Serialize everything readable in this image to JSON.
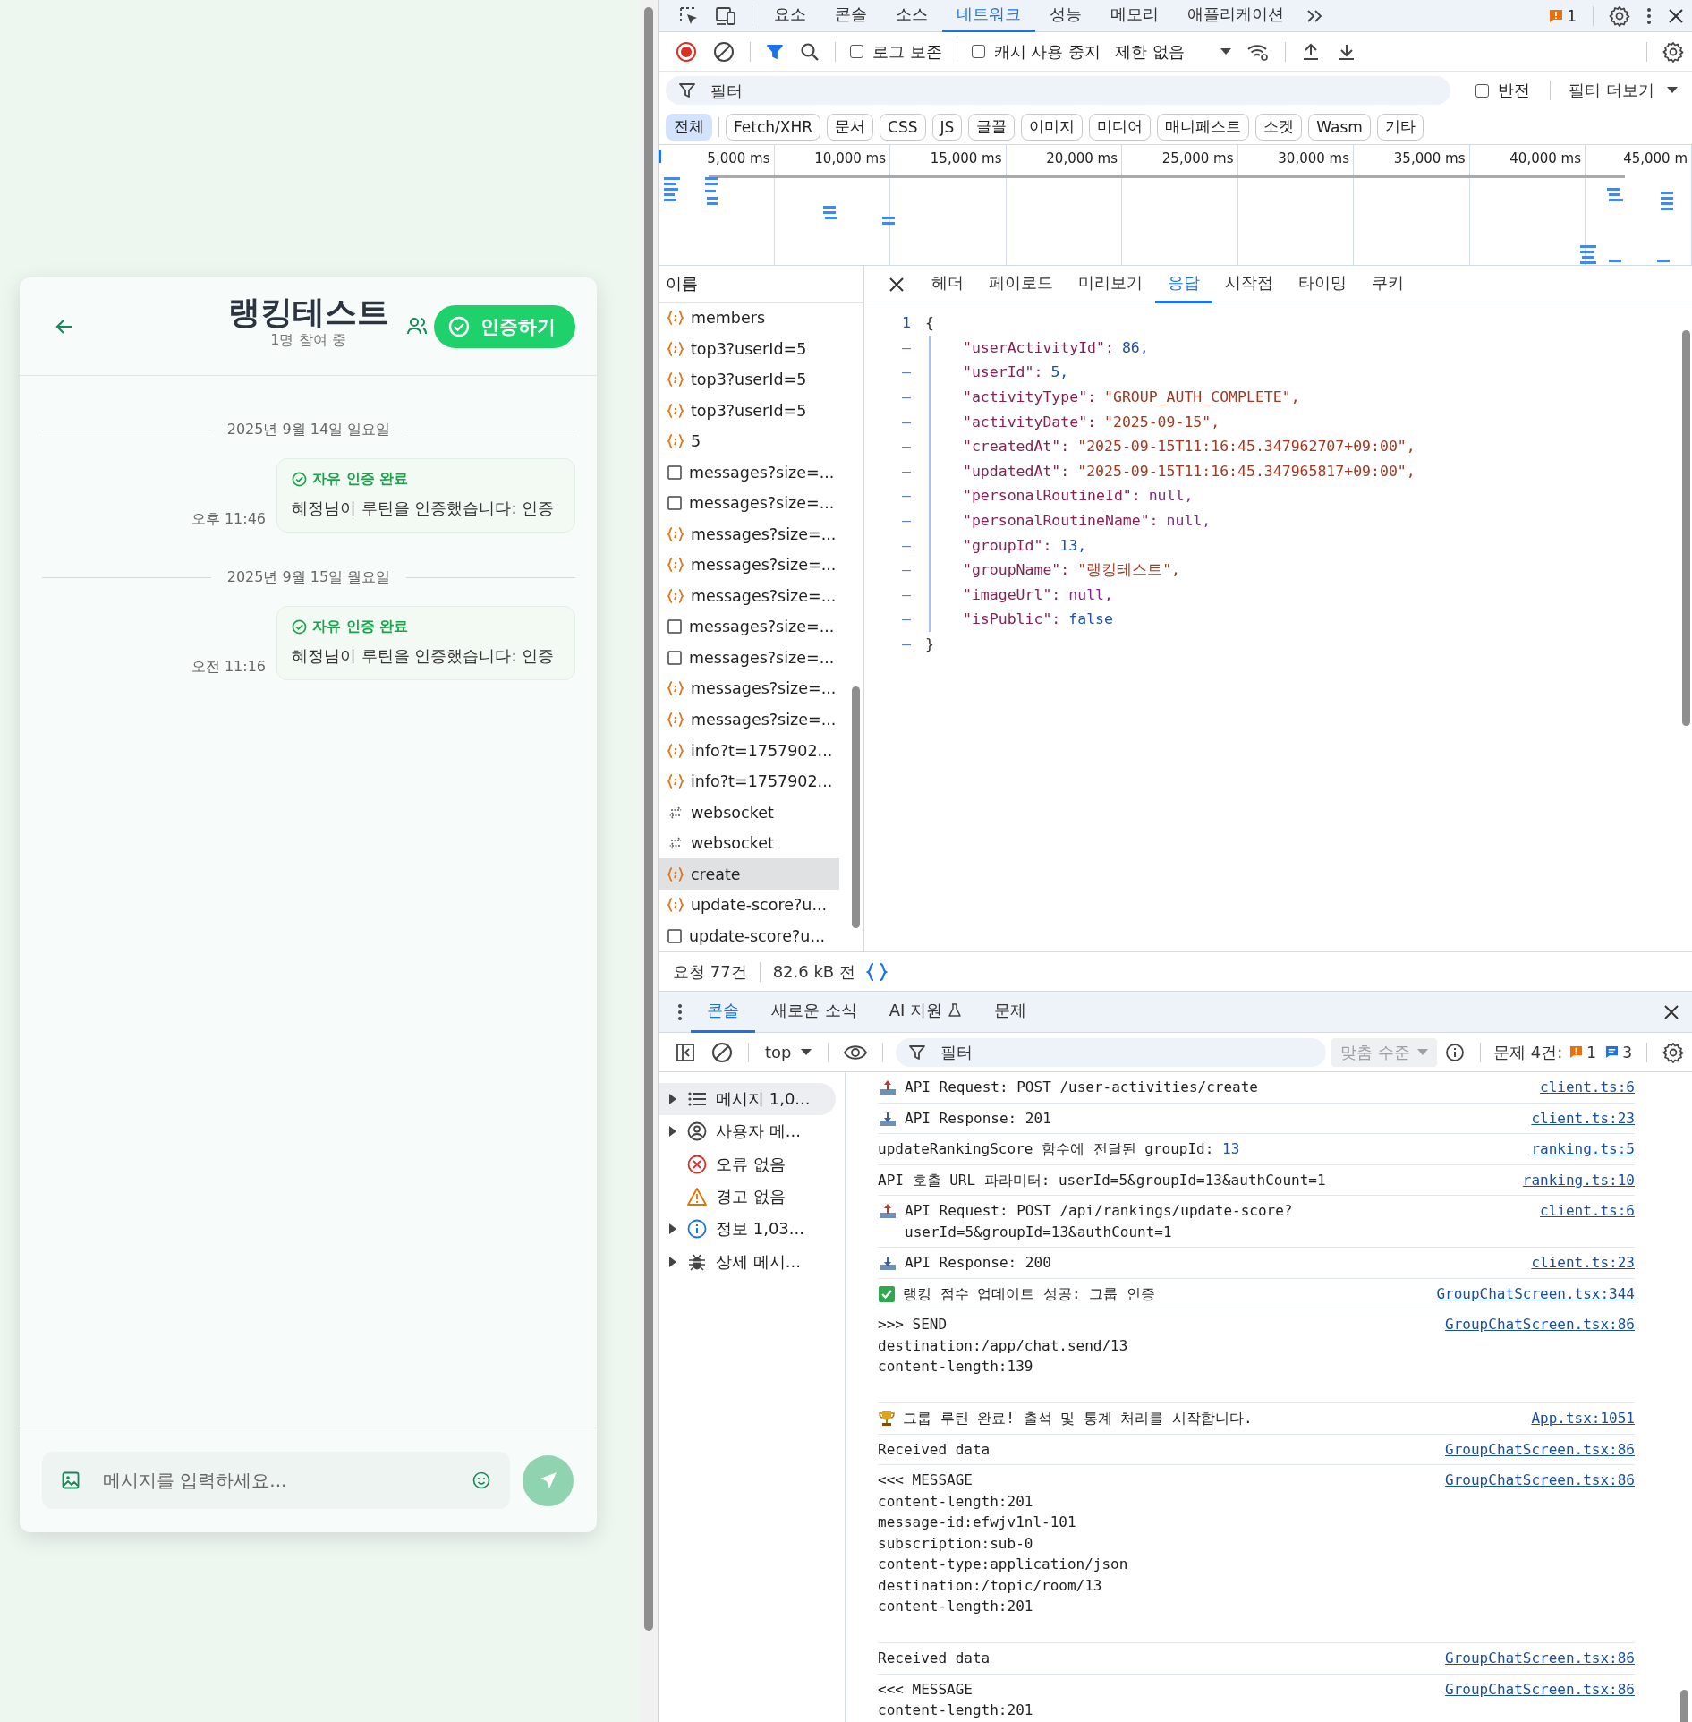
{
  "chat": {
    "title": "랭킹테스트",
    "subtitle": "1명 참여 중",
    "action_button": "인증하기",
    "timeline": [
      {
        "kind": "date",
        "text": "2025년 9월 14일 일요일"
      },
      {
        "kind": "message",
        "label": "자유 인증 완료",
        "text": "혜정님이 루틴을 인증했습니다: 인증",
        "time": "오후 11:46"
      },
      {
        "kind": "date",
        "text": "2025년 9월 15일 월요일"
      },
      {
        "kind": "message",
        "label": "자유 인증 완료",
        "text": "혜정님이 루틴을 인증했습니다: 인증",
        "time": "오전 11:16"
      }
    ],
    "input": {
      "placeholder": "메시지를 입력하세요..."
    }
  },
  "devtools": {
    "main_tabs": [
      {
        "label": "요소",
        "selected": false
      },
      {
        "label": "콘솔",
        "selected": false
      },
      {
        "label": "소스",
        "selected": false
      },
      {
        "label": "네트워크",
        "selected": true
      },
      {
        "label": "성능",
        "selected": false
      },
      {
        "label": "메모리",
        "selected": false
      },
      {
        "label": "애플리케이션",
        "selected": false
      }
    ],
    "issues_badge": "1",
    "network_toolbar": {
      "preserve_log": {
        "label": "로그 보존",
        "checked": false
      },
      "disable_cache": {
        "label": "캐시 사용 중지",
        "checked": false
      },
      "throttling": "제한 없음"
    },
    "filter": {
      "placeholder": "필터",
      "invert": {
        "label": "반전",
        "checked": false
      },
      "more_filters": "필터 더보기"
    },
    "type_filters": [
      {
        "label": "전체",
        "selected": true
      },
      {
        "label": "Fetch/XHR",
        "selected": false
      },
      {
        "label": "문서",
        "selected": false
      },
      {
        "label": "CSS",
        "selected": false
      },
      {
        "label": "JS",
        "selected": false
      },
      {
        "label": "글꼴",
        "selected": false
      },
      {
        "label": "이미지",
        "selected": false
      },
      {
        "label": "미디어",
        "selected": false
      },
      {
        "label": "매니페스트",
        "selected": false
      },
      {
        "label": "소켓",
        "selected": false
      },
      {
        "label": "Wasm",
        "selected": false
      },
      {
        "label": "기타",
        "selected": false
      }
    ],
    "timeline": {
      "ticks": [
        "5,000 ms",
        "10,000 ms",
        "15,000 ms",
        "20,000 ms",
        "25,000 ms",
        "30,000 ms",
        "35,000 ms",
        "40,000 ms",
        "45,000 m"
      ]
    },
    "requests": {
      "header": "이름",
      "items": [
        {
          "name": "members",
          "kind": "fetch",
          "selected": false
        },
        {
          "name": "top3?userId=5",
          "kind": "fetch",
          "selected": false
        },
        {
          "name": "top3?userId=5",
          "kind": "fetch",
          "selected": false
        },
        {
          "name": "top3?userId=5",
          "kind": "fetch",
          "selected": false
        },
        {
          "name": "5",
          "kind": "fetch",
          "selected": false
        },
        {
          "name": "messages?size=...",
          "kind": "document",
          "selected": false
        },
        {
          "name": "messages?size=...",
          "kind": "document",
          "selected": false
        },
        {
          "name": "messages?size=...",
          "kind": "fetch",
          "selected": false
        },
        {
          "name": "messages?size=...",
          "kind": "fetch",
          "selected": false
        },
        {
          "name": "messages?size=...",
          "kind": "fetch",
          "selected": false
        },
        {
          "name": "messages?size=...",
          "kind": "document",
          "selected": false
        },
        {
          "name": "messages?size=...",
          "kind": "document",
          "selected": false
        },
        {
          "name": "messages?size=...",
          "kind": "fetch",
          "selected": false
        },
        {
          "name": "messages?size=...",
          "kind": "fetch",
          "selected": false
        },
        {
          "name": "info?t=1757902...",
          "kind": "fetch",
          "selected": false
        },
        {
          "name": "info?t=1757902...",
          "kind": "fetch",
          "selected": false
        },
        {
          "name": "websocket",
          "kind": "websocket",
          "selected": false
        },
        {
          "name": "websocket",
          "kind": "websocket",
          "selected": false
        },
        {
          "name": "create",
          "kind": "fetch",
          "selected": true
        },
        {
          "name": "update-score?u...",
          "kind": "fetch",
          "selected": false
        },
        {
          "name": "update-score?u...",
          "kind": "document",
          "selected": false
        }
      ]
    },
    "detail_tabs": [
      {
        "label": "헤더",
        "selected": false
      },
      {
        "label": "페이로드",
        "selected": false
      },
      {
        "label": "미리보기",
        "selected": false
      },
      {
        "label": "응답",
        "selected": true
      },
      {
        "label": "시작점",
        "selected": false
      },
      {
        "label": "타이밍",
        "selected": false
      },
      {
        "label": "쿠키",
        "selected": false
      }
    ],
    "response": {
      "lines": [
        {
          "gutter": "1",
          "text": "{"
        },
        {
          "gutter": "–",
          "key": "\"userActivityId\":",
          "value": "86,",
          "kind": "number"
        },
        {
          "gutter": "–",
          "key": "\"userId\":",
          "value": "5,",
          "kind": "number"
        },
        {
          "gutter": "–",
          "key": "\"activityType\":",
          "value": "\"GROUP_AUTH_COMPLETE\",",
          "kind": "string"
        },
        {
          "gutter": "–",
          "key": "\"activityDate\":",
          "value": "\"2025-09-15\",",
          "kind": "string"
        },
        {
          "gutter": "–",
          "key": "\"createdAt\":",
          "value": "\"2025-09-15T11:16:45.347962707+09:00\",",
          "kind": "string"
        },
        {
          "gutter": "–",
          "key": "\"updatedAt\":",
          "value": "\"2025-09-15T11:16:45.347965817+09:00\",",
          "kind": "string"
        },
        {
          "gutter": "–",
          "key": "\"personalRoutineId\":",
          "value": "null,",
          "kind": "null"
        },
        {
          "gutter": "–",
          "key": "\"personalRoutineName\":",
          "value": "null,",
          "kind": "null"
        },
        {
          "gutter": "–",
          "key": "\"groupId\":",
          "value": "13,",
          "kind": "number"
        },
        {
          "gutter": "–",
          "key": "\"groupName\":",
          "value": "\"랭킹테스트\",",
          "kind": "string"
        },
        {
          "gutter": "–",
          "key": "\"imageUrl\":",
          "value": "null,",
          "kind": "null"
        },
        {
          "gutter": "–",
          "key": "\"isPublic\":",
          "value": "false",
          "kind": "boolean"
        },
        {
          "gutter": "–",
          "text": "}"
        }
      ]
    },
    "status_bar": {
      "requests": "요청 77건",
      "transferred": "82.6 kB 전"
    },
    "drawer_tabs": [
      {
        "label": "콘솔",
        "selected": true,
        "experimental": false
      },
      {
        "label": "새로운 소식",
        "selected": false,
        "experimental": false
      },
      {
        "label": "AI 지원",
        "selected": false,
        "experimental": true
      },
      {
        "label": "문제",
        "selected": false,
        "experimental": false
      }
    ],
    "console_toolbar": {
      "context": "top",
      "filter_placeholder": "필터",
      "levels": "맞춤 수준",
      "issues_label": "문제 4건:",
      "error_count": "1",
      "info_count": "3"
    },
    "console_sidebar": [
      {
        "label": "메시지 1,0...",
        "kind": "messages",
        "expandable": true,
        "selected": true
      },
      {
        "label": "사용자 메...",
        "kind": "user",
        "expandable": true,
        "selected": false
      },
      {
        "label": "오류 없음",
        "kind": "error",
        "expandable": false,
        "selected": false
      },
      {
        "label": "경고 없음",
        "kind": "warning",
        "expandable": false,
        "selected": false
      },
      {
        "label": "정보 1,03...",
        "kind": "info",
        "expandable": true,
        "selected": false
      },
      {
        "label": "상세 메시...",
        "kind": "verbose",
        "expandable": true,
        "selected": false
      }
    ],
    "console_messages": [
      {
        "kind": "request",
        "lines": [
          "API Request: POST /user-activities/create"
        ],
        "source": "client.ts:6"
      },
      {
        "kind": "response",
        "lines": [
          "API Response: 201"
        ],
        "source": "client.ts:23"
      },
      {
        "kind": "log",
        "lines": [
          "updateRankingScore 함수에 전달된 groupId:"
        ],
        "value": "13",
        "source": "ranking.ts:5"
      },
      {
        "kind": "log",
        "lines": [
          "API 호출 URL 파라미터: userId=5&groupId=13&authCount=1"
        ],
        "source": "ranking.ts:10"
      },
      {
        "kind": "request",
        "lines": [
          "API Request: POST /api/rankings/update-score?",
          "userId=5&groupId=13&authCount=1"
        ],
        "source": "client.ts:6"
      },
      {
        "kind": "response",
        "lines": [
          "API Response: 200"
        ],
        "source": "client.ts:23"
      },
      {
        "kind": "success",
        "lines": [
          "랭킹 점수 업데이트 성공: 그룹 인증"
        ],
        "source": "GroupChatScreen.tsx:344"
      },
      {
        "kind": "frame",
        "lines": [
          ">>> SEND",
          "destination:/app/chat.send/13",
          "content-length:139"
        ],
        "source": "GroupChatScreen.tsx:86"
      },
      {
        "kind": "trophy",
        "lines": [
          "그룹 루틴 완료! 출석 및 통계 처리를 시작합니다."
        ],
        "source": "App.tsx:1051"
      },
      {
        "kind": "log",
        "lines": [
          "Received data"
        ],
        "source": "GroupChatScreen.tsx:86"
      },
      {
        "kind": "frame",
        "lines": [
          "<<< MESSAGE",
          "content-length:201",
          "message-id:efwjv1nl-101",
          "subscription:sub-0",
          "content-type:application/json",
          "destination:/topic/room/13",
          "content-length:201"
        ],
        "source": "GroupChatScreen.tsx:86"
      },
      {
        "kind": "log",
        "lines": [
          "Received data"
        ],
        "source": "GroupChatScreen.tsx:86"
      },
      {
        "kind": "log",
        "lines": [
          "<<< MESSAGE",
          "content-length:201"
        ],
        "source": "GroupChatScreen.tsx:86"
      }
    ]
  }
}
